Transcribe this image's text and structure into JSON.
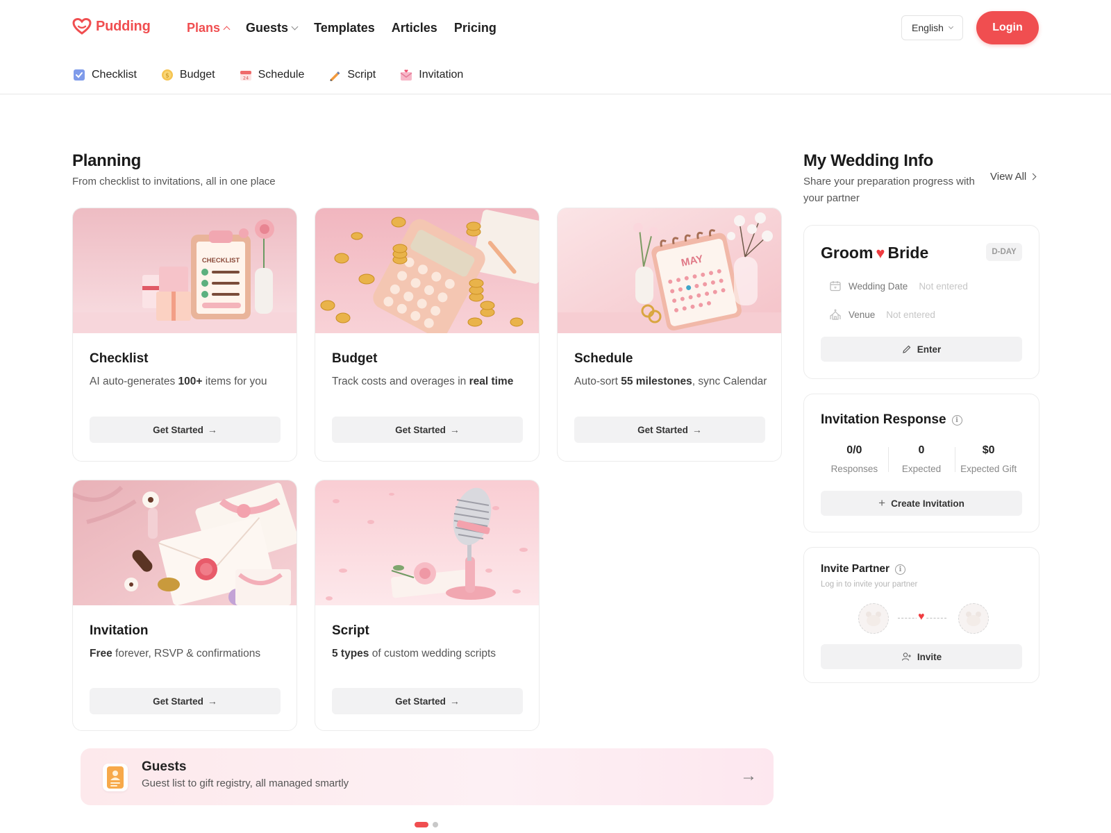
{
  "brand": {
    "name": "Pudding",
    "accent": "#f04e50"
  },
  "nav": {
    "items": [
      {
        "label": "Plans",
        "active": true,
        "caret": "up"
      },
      {
        "label": "Guests",
        "caret": "down"
      },
      {
        "label": "Templates"
      },
      {
        "label": "Articles"
      },
      {
        "label": "Pricing"
      }
    ],
    "language": "English",
    "login": "Login"
  },
  "subnav": [
    {
      "label": "Checklist",
      "icon": "checkbox-icon"
    },
    {
      "label": "Budget",
      "icon": "coin-icon"
    },
    {
      "label": "Schedule",
      "icon": "calendar-icon"
    },
    {
      "label": "Script",
      "icon": "pen-icon"
    },
    {
      "label": "Invitation",
      "icon": "envelope-icon"
    }
  ],
  "planning": {
    "title": "Planning",
    "subtitle": "From checklist to invitations, all in one place",
    "cards": [
      {
        "title": "Checklist",
        "desc_pre": "AI auto-generates ",
        "desc_bold": "100+",
        "desc_post": " items for you",
        "button": "Get Started"
      },
      {
        "title": "Budget",
        "desc_pre": "Track costs and overages in ",
        "desc_bold": "real time",
        "desc_post": "",
        "button": "Get Started"
      },
      {
        "title": "Schedule",
        "desc_pre": "Auto-sort ",
        "desc_bold": "55 milestones",
        "desc_post": ", sync Calendar",
        "button": "Get Started"
      },
      {
        "title": "Invitation",
        "desc_pre": "",
        "desc_bold": "Free",
        "desc_post": " forever, RSVP & confirmations",
        "button": "Get Started"
      },
      {
        "title": "Script",
        "desc_pre": "",
        "desc_bold": "5 types",
        "desc_post": " of custom wedding scripts",
        "button": "Get Started"
      }
    ],
    "checklist_art": "CHECKLIST",
    "calendar_art": "MAY"
  },
  "guests_banner": {
    "title": "Guests",
    "subtitle": "Guest list to gift registry, all managed smartly"
  },
  "carousel": {
    "pages": 2,
    "current": 1
  },
  "wedding_info": {
    "title": "My Wedding Info",
    "subtitle": "Share your preparation progress with your partner",
    "view_all": "View All",
    "couple": {
      "groom": "Groom",
      "bride": "Bride",
      "badge": "D-DAY"
    },
    "wedding_date_label": "Wedding Date",
    "wedding_date_value": "Not entered",
    "venue_label": "Venue",
    "venue_value": "Not entered",
    "enter_button": "Enter"
  },
  "invitation_response": {
    "title": "Invitation Response",
    "stats": [
      {
        "value": "0/0",
        "label": "Responses"
      },
      {
        "value": "0",
        "label": "Expected"
      },
      {
        "value": "$0",
        "label": "Expected Gift"
      }
    ],
    "button": "Create Invitation"
  },
  "invite_partner": {
    "title": "Invite Partner",
    "subtitle": "Log in to invite your partner",
    "button": "Invite"
  }
}
